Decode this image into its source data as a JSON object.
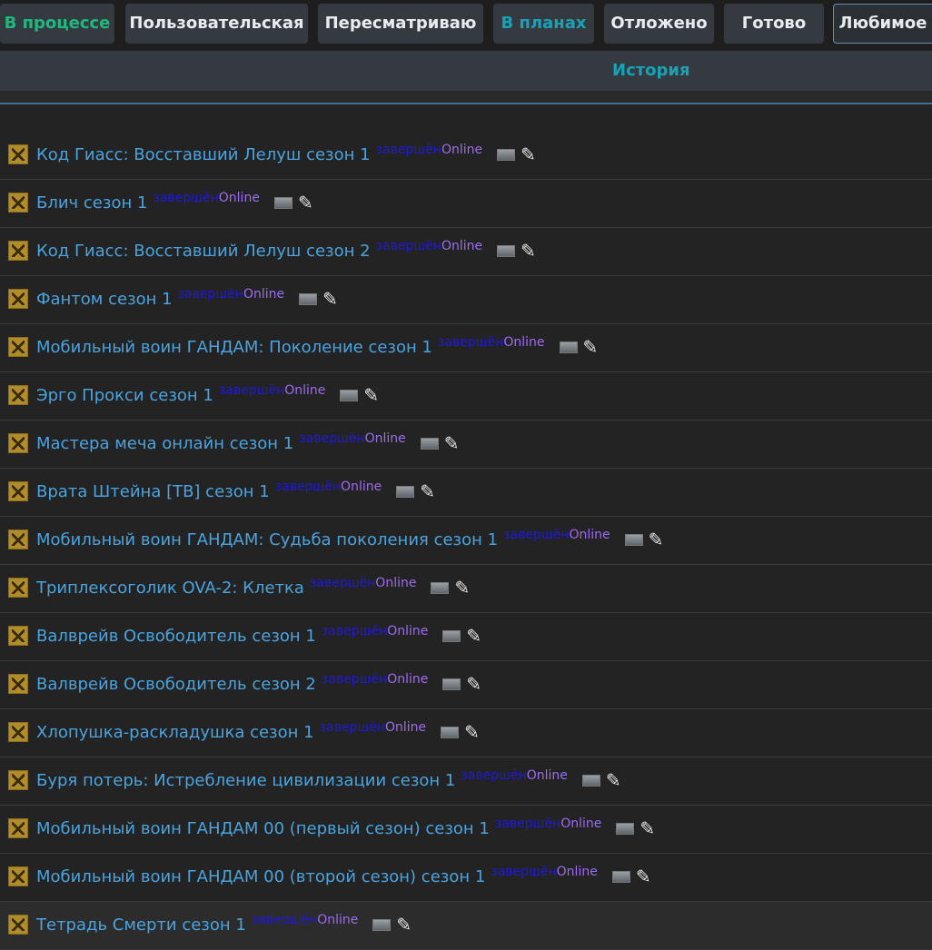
{
  "tabs": [
    {
      "label": "В процессе"
    },
    {
      "label": "Пользовательская"
    },
    {
      "label": "Пересматриваю"
    },
    {
      "label": "В планах"
    },
    {
      "label": "Отложено"
    },
    {
      "label": "Готово"
    },
    {
      "label": "Любимое"
    }
  ],
  "history": {
    "label": "История"
  },
  "entries": [
    {
      "title": "Код Гиасс: Восставший Лелуш сезон 1",
      "status": "завершён",
      "online": "Online"
    },
    {
      "title": "Блич сезон 1",
      "status": "завершён",
      "online": "Online"
    },
    {
      "title": "Код Гиасс: Восставший Лелуш сезон 2",
      "status": "завершён",
      "online": "Online"
    },
    {
      "title": "Фантом сезон 1",
      "status": "завершён",
      "online": "Online"
    },
    {
      "title": "Мобильный воин ГАНДАМ: Поколение сезон 1",
      "status": "завершён",
      "online": "Online"
    },
    {
      "title": "Эрго Прокси сезон 1",
      "status": "завершён",
      "online": "Online"
    },
    {
      "title": "Мастера меча онлайн сезон 1",
      "status": "завершён",
      "online": "Online"
    },
    {
      "title": "Врата Штейна [ТВ] сезон 1",
      "status": "завершён",
      "online": "Online"
    },
    {
      "title": "Мобильный воин ГАНДАМ: Судьба поколения сезон 1",
      "status": "завершён",
      "online": "Online"
    },
    {
      "title": "Триплексоголик OVA-2: Клетка",
      "status": "завершён",
      "online": "Online"
    },
    {
      "title": "Валврейв Освободитель сезон 1",
      "status": "завершён",
      "online": "Online"
    },
    {
      "title": "Валврейв Освободитель сезон 2",
      "status": "завершён",
      "online": "Online"
    },
    {
      "title": "Хлопушка-раскладушка сезон 1",
      "status": "завершён",
      "online": "Online"
    },
    {
      "title": "Буря потерь: Истребление цивилизации сезон 1",
      "status": "завершён",
      "online": "Online"
    },
    {
      "title": "Мобильный воин ГАНДАМ 00 (первый сезон) сезон 1",
      "status": "завершён",
      "online": "Online"
    },
    {
      "title": "Мобильный воин ГАНДАМ 00 (второй сезон) сезон 1",
      "status": "завершён",
      "online": "Online"
    },
    {
      "title": "Тетрадь Смерти сезон 1",
      "status": "завершён",
      "online": "Online"
    }
  ],
  "icons": {
    "entry_icon": "anime-thumbnail-icon",
    "image": "image-icon",
    "edit": "pencil-icon"
  },
  "colors": {
    "title": "#4aa3df",
    "status": "#2019d8",
    "online": "#9b6bf0",
    "accent_green": "#1fb980",
    "accent_cyan": "#17a2b8"
  }
}
